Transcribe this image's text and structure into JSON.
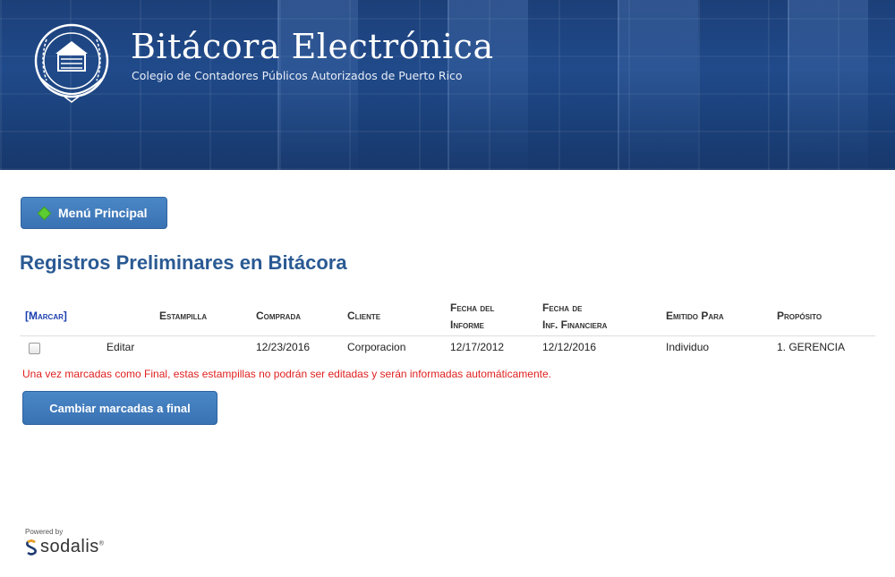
{
  "header": {
    "title": "Bitácora Electrónica",
    "subtitle": "Colegio de Contadores Públicos Autorizados de Puerto Rico",
    "logo_icon": "cpa-seal-icon"
  },
  "nav": {
    "menu_button_label": "Menú Principal",
    "menu_button_icon": "green-diamond-arrow-icon"
  },
  "page": {
    "title": "Registros Preliminares en Bitácora"
  },
  "table": {
    "headers": {
      "marcar": "[Marcar]",
      "estampilla": "Estampilla",
      "comprada": "Comprada",
      "cliente": "Cliente",
      "fecha_informe_1": "Fecha del",
      "fecha_informe_2": "Informe",
      "fecha_inf_fin_1": "Fecha de",
      "fecha_inf_fin_2": "Inf. Financiera",
      "emitido_para": "Emitido Para",
      "proposito": "Propósito"
    },
    "rows": [
      {
        "checked": false,
        "action": "Editar",
        "estampilla": "",
        "comprada": "12/23/2016",
        "cliente": "Corporacion",
        "fecha_informe": "12/17/2012",
        "fecha_inf_financiera": "12/12/2016",
        "emitido_para": "Individuo",
        "proposito": "1. GERENCIA"
      }
    ]
  },
  "warning_text": "Una vez marcadas como Final, estas estampillas no podrán ser editadas y serán informadas automáticamente.",
  "final_button_label": "Cambiar marcadas a final",
  "footer": {
    "powered_by": "Powered by",
    "brand": "sodalis",
    "brand_mark": "®"
  },
  "colors": {
    "banner": "#1f4683",
    "accent_button": "#3f7bbd",
    "title": "#2a5a93",
    "warning": "#e02020",
    "link": "#1a3fae"
  }
}
